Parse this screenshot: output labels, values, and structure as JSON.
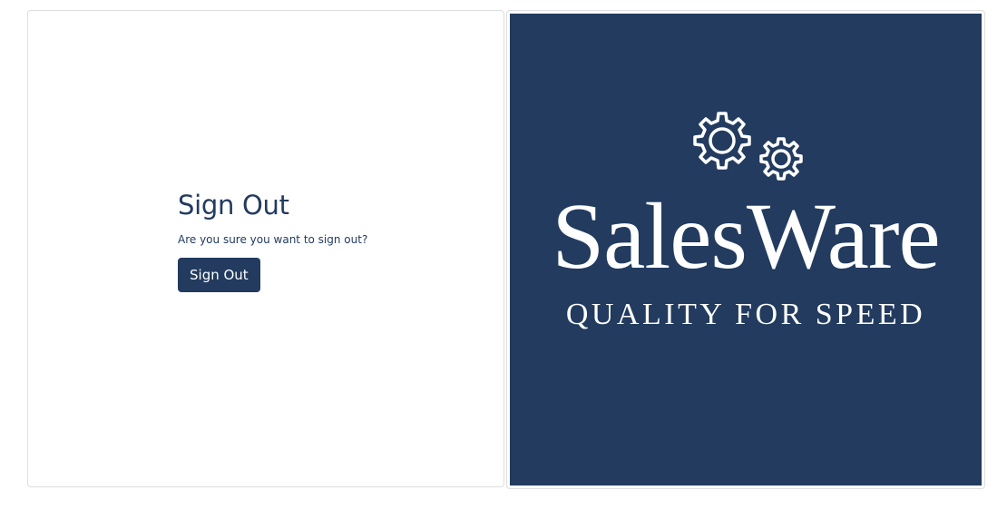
{
  "signout": {
    "title": "Sign Out",
    "prompt": "Are you sure you want to sign out?",
    "button_label": "Sign Out"
  },
  "logo": {
    "brand": "SalesWare",
    "tagline": "QUALITY FOR SPEED",
    "icon": "gears-icon"
  },
  "colors": {
    "brand_navy": "#223b5f",
    "card_border": "#dedede",
    "background": "#ffffff",
    "logo_text": "#ffffff"
  }
}
